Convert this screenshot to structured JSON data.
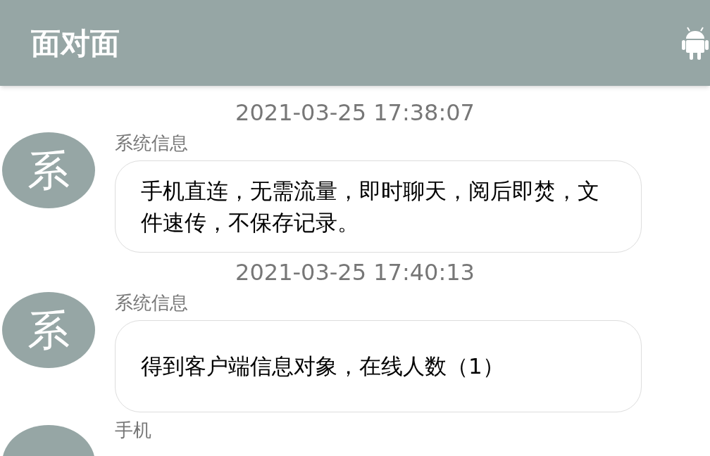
{
  "app_bar": {
    "title": "面对面"
  },
  "messages": [
    {
      "time": "2021-03-25 17:38:07",
      "avatar": "系",
      "sender": "系统信息",
      "text": "手机直连，无需流量，即时聊天，阅后即焚，文件速传，不保存记录。"
    },
    {
      "time": "2021-03-25 17:40:13",
      "avatar": "系",
      "sender": "系统信息",
      "text": "得到客户端信息对象，在线人数（1）"
    },
    {
      "sender": "手机"
    }
  ]
}
